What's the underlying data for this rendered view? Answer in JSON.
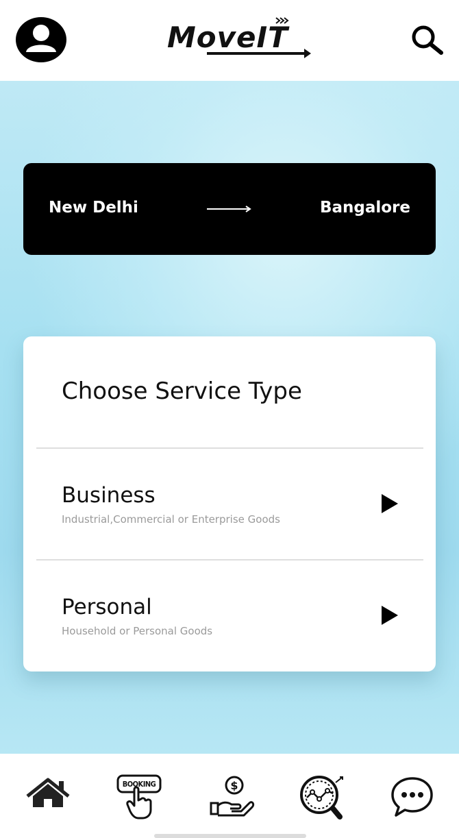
{
  "app": {
    "logo_text": "MoveIT"
  },
  "header": {
    "profile_icon": "user-circle-icon",
    "search_icon": "search-icon"
  },
  "route": {
    "from": "New Delhi",
    "to": "Bangalore",
    "arrow_icon": "long-arrow-right-icon"
  },
  "service": {
    "title": "Choose Service Type",
    "options": [
      {
        "title": "Business",
        "subtitle": "Industrial,Commercial or Enterprise Goods",
        "icon": "play-triangle-icon"
      },
      {
        "title": "Personal",
        "subtitle": "Household or Personal Goods",
        "icon": "play-triangle-icon"
      }
    ]
  },
  "tabbar": {
    "items": [
      {
        "icon": "home-icon"
      },
      {
        "icon": "booking-icon",
        "label": "BOOKING"
      },
      {
        "icon": "payment-hand-icon"
      },
      {
        "icon": "analytics-search-icon"
      },
      {
        "icon": "chat-bubble-icon"
      }
    ]
  },
  "colors": {
    "background_top": "#bfe9f5",
    "background_bottom": "#9edaee",
    "route_bg": "#000000",
    "card_bg": "#ffffff",
    "text": "#111111",
    "subtext": "#9a9a9a"
  }
}
